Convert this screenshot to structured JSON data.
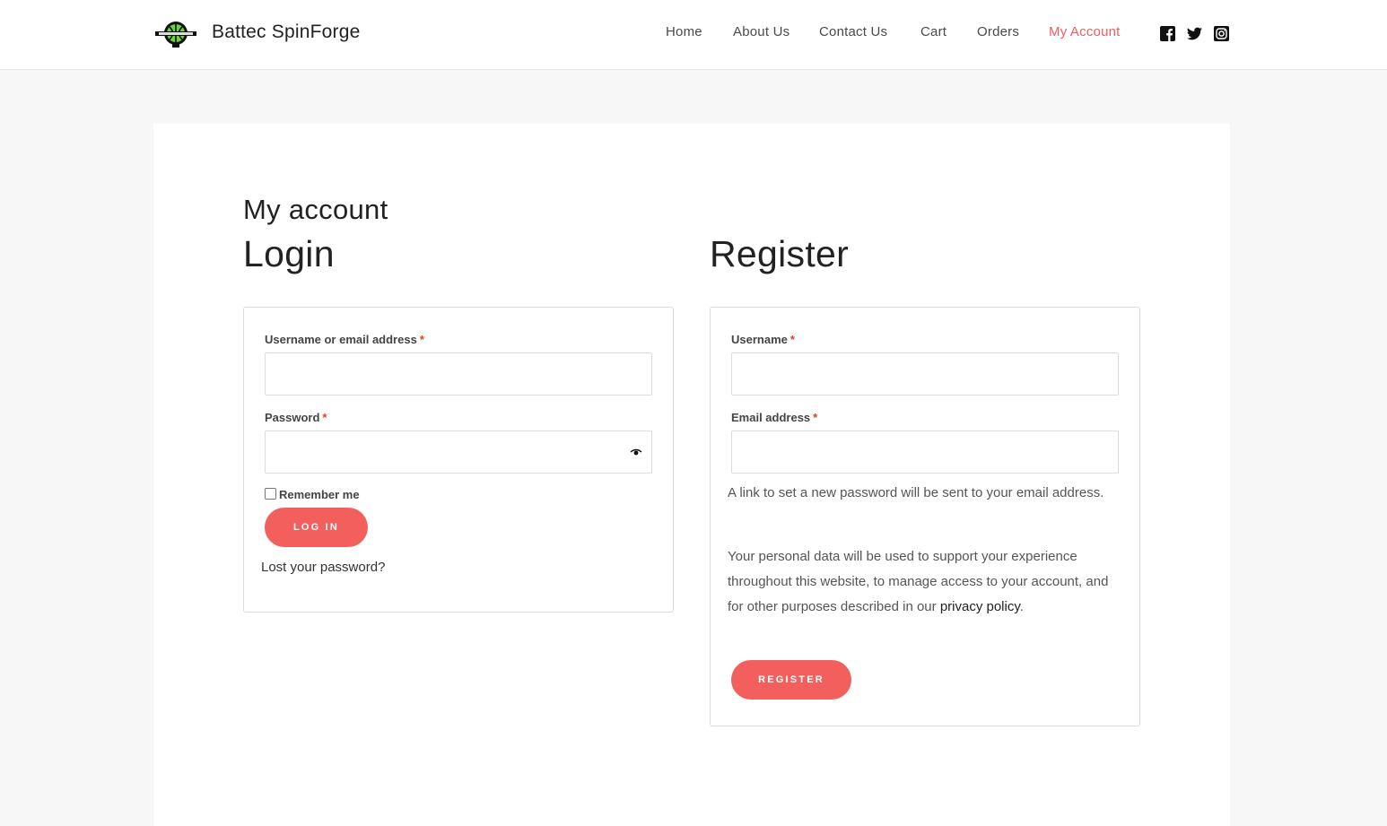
{
  "site": {
    "title": "Battec SpinForge",
    "logo_icon": "globe-gear-logo-icon"
  },
  "nav": {
    "items": [
      {
        "label": "Home",
        "active": false
      },
      {
        "label": "About Us",
        "active": false
      },
      {
        "label": "Contact Us",
        "active": false
      },
      {
        "label": "Cart",
        "active": false
      },
      {
        "label": "Orders",
        "active": false
      },
      {
        "label": "My Account",
        "active": true
      }
    ],
    "social_icons": [
      "facebook-icon",
      "twitter-icon",
      "instagram-icon"
    ]
  },
  "page": {
    "title": "My account"
  },
  "login": {
    "heading": "Login",
    "username_label": "Username or email address",
    "password_label": "Password",
    "required_mark": "*",
    "remember_label": "Remember me",
    "submit_label": "LOG IN",
    "lost_password": "Lost your password?"
  },
  "register": {
    "heading": "Register",
    "username_label": "Username",
    "email_label": "Email address",
    "required_mark": "*",
    "password_note": "A link to set a new password will be sent to your email address.",
    "privacy_text": "Your personal data will be used to support your experience throughout this website, to manage access to your account, and for other purposes described in our",
    "privacy_link": "privacy policy",
    "privacy_end": ".",
    "submit_label": "REGISTER"
  },
  "colors": {
    "accent": "#f25f5c",
    "active_nav": "#e8605f",
    "required": "#e2401c",
    "page_bg": "#f7f7f7"
  }
}
